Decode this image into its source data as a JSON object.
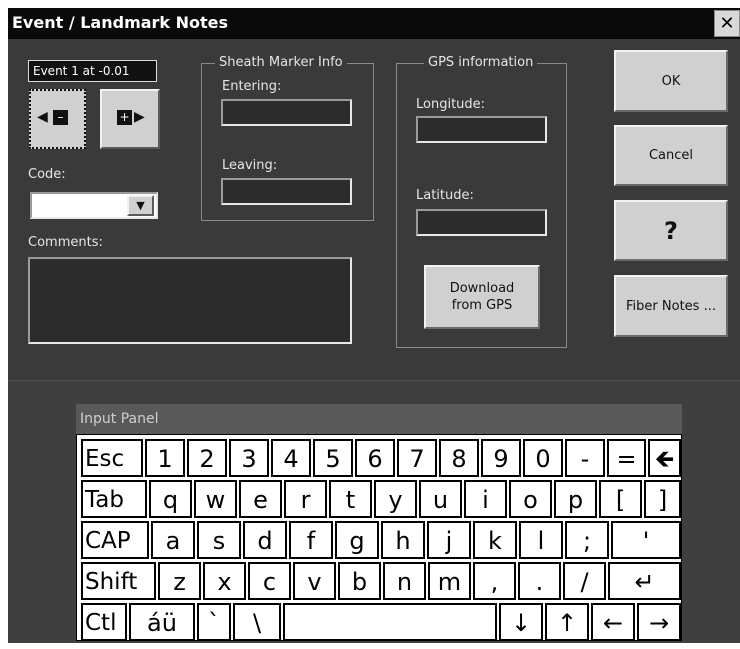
{
  "window": {
    "title": "Event / Landmark Notes",
    "close_glyph": "✕"
  },
  "event": {
    "label": "Event 1 at -0.01"
  },
  "code": {
    "label": "Code:",
    "value": "",
    "dropdown_glyph": "▼"
  },
  "comments": {
    "label": "Comments:",
    "value": ""
  },
  "sheath": {
    "legend": "Sheath Marker Info",
    "entering_label": "Entering:",
    "entering_value": "",
    "leaving_label": "Leaving:",
    "leaving_value": ""
  },
  "gps": {
    "legend": "GPS information",
    "longitude_label": "Longitude:",
    "longitude_value": "",
    "latitude_label": "Latitude:",
    "latitude_value": "",
    "download_line1": "Download",
    "download_line2": "from GPS"
  },
  "buttons": {
    "ok": "OK",
    "cancel": "Cancel",
    "help": "?",
    "fiber_notes": "Fiber Notes ..."
  },
  "input_panel": {
    "title": "Input Panel",
    "rows": [
      [
        "Esc",
        "1",
        "2",
        "3",
        "4",
        "5",
        "6",
        "7",
        "8",
        "9",
        "0",
        "-",
        "=",
        "🡸"
      ],
      [
        "Tab",
        "q",
        "w",
        "e",
        "r",
        "t",
        "y",
        "u",
        "i",
        "o",
        "p",
        "[",
        "]"
      ],
      [
        "CAP",
        "a",
        "s",
        "d",
        "f",
        "g",
        "h",
        "j",
        "k",
        "l",
        ";",
        "'"
      ],
      [
        "Shift",
        "z",
        "x",
        "c",
        "v",
        "b",
        "n",
        "m",
        ",",
        ".",
        "/",
        "↵"
      ],
      [
        "Ctl",
        "áü",
        "`",
        "\\",
        "",
        "↓",
        "↑",
        "←",
        "→"
      ]
    ]
  }
}
